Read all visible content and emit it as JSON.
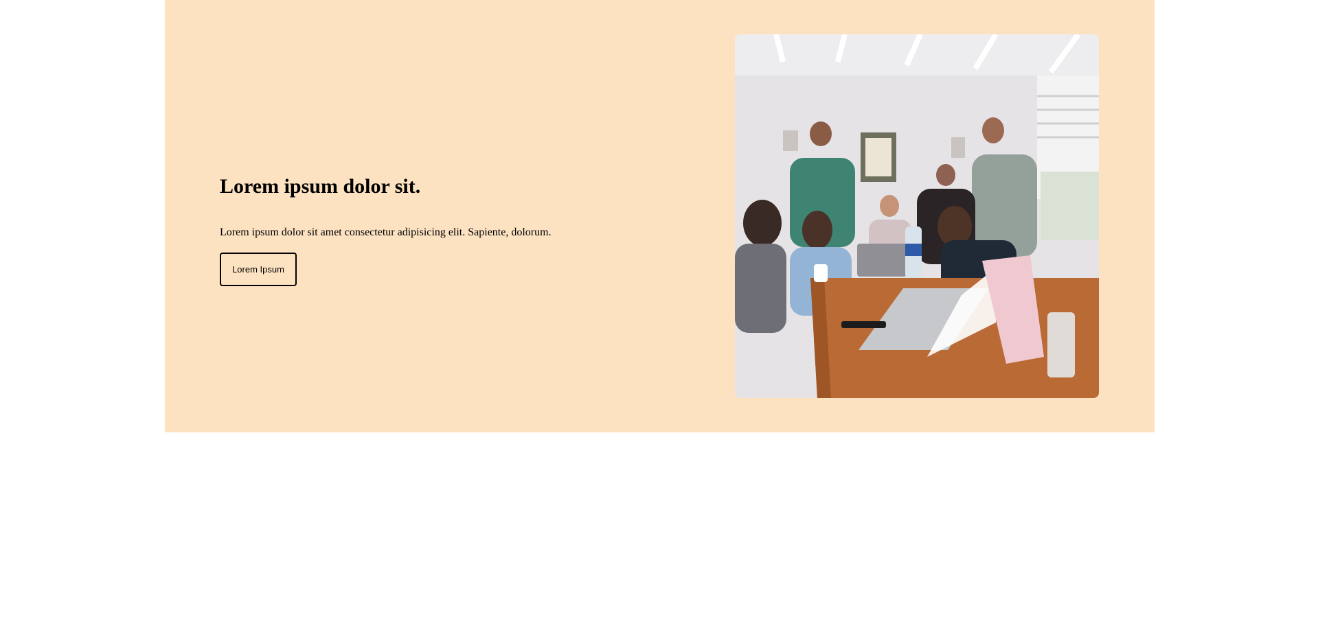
{
  "hero": {
    "title": "Lorem ipsum dolor sit.",
    "description": "Lorem ipsum dolor sit amet consectetur adipisicing elit. Sapiente, dolorum.",
    "button_label": "Lorem Ipsum",
    "background_color": "#fde2c2"
  },
  "image": {
    "subject": "team-meeting-photo"
  }
}
